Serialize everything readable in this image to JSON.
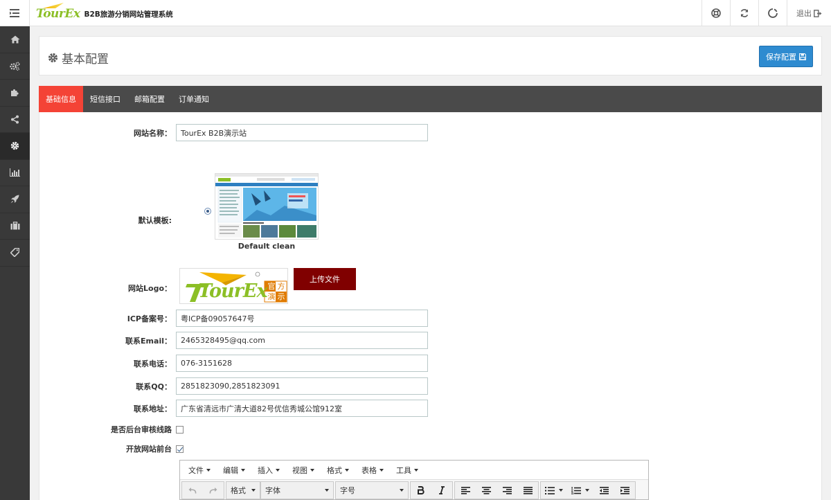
{
  "header": {
    "logo_text": "TourEx",
    "system_title": "B2B旅游分销网站管理系统",
    "logout_label": "退出"
  },
  "sidebar": {
    "items": [
      "home-icon",
      "gears-icon",
      "puzzle-icon",
      "share-icon",
      "gear-icon",
      "bar-chart-icon",
      "rocket-icon",
      "briefcase-icon",
      "tag-icon"
    ],
    "active_index": 4
  },
  "page": {
    "title": "基本配置",
    "save_label": "保存配置"
  },
  "tabs": [
    {
      "label": "基础信息",
      "active": true
    },
    {
      "label": "短信接口",
      "active": false
    },
    {
      "label": "邮箱配置",
      "active": false
    },
    {
      "label": "订单通知",
      "active": false
    }
  ],
  "form": {
    "site_name_label": "网站名称：",
    "site_name_value": "TourEx B2B演示站",
    "template_label": "默认模板:",
    "template_name": "Default clean",
    "logo_label": "网站Logo：",
    "logo_text": "TourEx",
    "logo_badge": [
      "官",
      "方",
      "演",
      "示"
    ],
    "upload_label": "上传文件",
    "icp_label": "ICP备案号：",
    "icp_value": "粤ICP备09057647号",
    "email_label": "联系Email：",
    "email_value": "2465328495@qq.com",
    "phone_label": "联系电话：",
    "phone_value": "076-3151628",
    "qq_label": "联系QQ：",
    "qq_value": "2851823090,2851823091",
    "address_label": "联系地址：",
    "address_value": "广东省清远市广清大道82号优信秀城公馆912室",
    "review_label": "是否后台审核线路",
    "review_checked": false,
    "open_site_label": "开放网站前台",
    "open_site_checked": true
  },
  "editor": {
    "menus": [
      "文件",
      "编辑",
      "插入",
      "视图",
      "格式",
      "表格",
      "工具"
    ],
    "format_label": "格式",
    "font_label": "字体",
    "size_label": "字号"
  },
  "colors": {
    "sidebar_bg": "#393939",
    "tab_bar_bg": "#4a4a4a",
    "active_tab": "#f44336",
    "save_button": "#2e8bd0",
    "upload_button": "#800000"
  }
}
